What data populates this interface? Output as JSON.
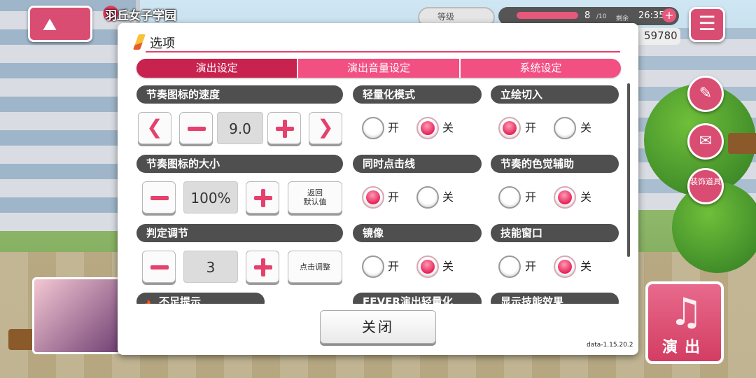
{
  "hud": {
    "location": "羽丘女子学园",
    "level_label": "等级",
    "stamina_count": "8",
    "stamina_max": "/10",
    "remain_label": "剩余",
    "timer": "26:35",
    "plus": "+",
    "coins": "59780",
    "live_label": "演出",
    "side_items": [
      "装饰道具"
    ]
  },
  "modal": {
    "title": "选项",
    "tabs": [
      "演出设定",
      "演出音量设定",
      "系统设定"
    ],
    "active_tab": 0,
    "close_label": "关闭",
    "version": "data-1.15.20.2"
  },
  "settings": {
    "note_speed": {
      "label": "节奏图标的速度",
      "value": "9.0"
    },
    "note_size": {
      "label": "节奏图标的大小",
      "value": "100%",
      "reset_label": "返回\n默认值"
    },
    "judge_adjust": {
      "label": "判定调节",
      "value": "3",
      "tap_adjust_label": "点击调整"
    },
    "insufficient_hint": {
      "label": "不足提示"
    },
    "light_mode": {
      "label": "轻量化模式",
      "selected": "关"
    },
    "portrait_cut": {
      "label": "立绘切入",
      "selected": "开"
    },
    "simul_line": {
      "label": "同时点击线",
      "selected": "开"
    },
    "color_assist": {
      "label": "节奏的色觉辅助",
      "selected": "关"
    },
    "mirror": {
      "label": "镜像",
      "selected": "关"
    },
    "skill_window": {
      "label": "技能窗口",
      "selected": "关"
    },
    "fever_light": {
      "label": "FEVER演出轻量化"
    },
    "skill_effect": {
      "label": "显示技能效果"
    },
    "on_label": "开",
    "off_label": "关"
  },
  "colors": {
    "accent": "#e6406d",
    "tab": "#f24f82",
    "tab_active": "#c8224f",
    "section_header": "#4f4f4f"
  }
}
